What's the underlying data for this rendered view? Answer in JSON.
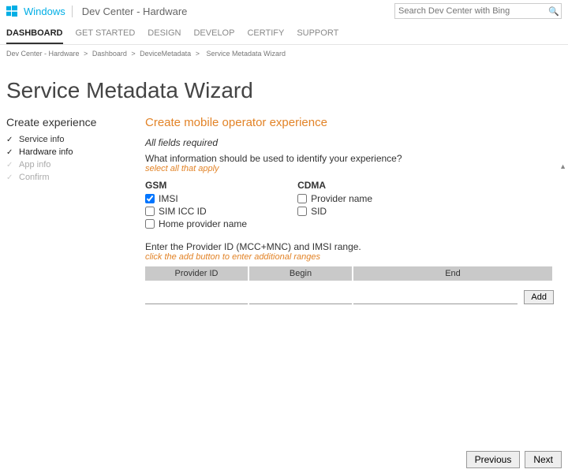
{
  "header": {
    "brand": "Windows",
    "subbrand": "Dev Center - Hardware",
    "search_placeholder": "Search Dev Center with Bing"
  },
  "nav": {
    "tabs": [
      "DASHBOARD",
      "GET STARTED",
      "DESIGN",
      "DEVELOP",
      "CERTIFY",
      "SUPPORT"
    ],
    "active_index": 0
  },
  "breadcrumb": {
    "parts": [
      "Dev Center - Hardware",
      "Dashboard",
      "DeviceMetadata",
      "Service Metadata Wizard"
    ],
    "sep": ">"
  },
  "page_title": "Service Metadata Wizard",
  "sidebar": {
    "title": "Create experience",
    "steps": [
      {
        "label": "Service info",
        "state": "done"
      },
      {
        "label": "Hardware info",
        "state": "current"
      },
      {
        "label": "App info",
        "state": "pending"
      },
      {
        "label": "Confirm",
        "state": "pending"
      }
    ]
  },
  "form": {
    "section_title": "Create mobile operator experience",
    "required_note": "All fields required",
    "question1": "What information should be used to identify your experience?",
    "hint1": "select all that apply",
    "gsm": {
      "label": "GSM",
      "options": [
        {
          "label": "IMSI",
          "checked": true
        },
        {
          "label": "SIM ICC ID",
          "checked": false
        },
        {
          "label": "Home provider name",
          "checked": false
        }
      ]
    },
    "cdma": {
      "label": "CDMA",
      "options": [
        {
          "label": "Provider name",
          "checked": false
        },
        {
          "label": "SID",
          "checked": false
        }
      ]
    },
    "question2": "Enter the Provider ID (MCC+MNC) and IMSI range.",
    "hint2": "click the add button to enter additional ranges",
    "table": {
      "headers": [
        "Provider ID",
        "Begin",
        "End"
      ]
    },
    "add_label": "Add"
  },
  "footer": {
    "previous": "Previous",
    "next": "Next"
  }
}
